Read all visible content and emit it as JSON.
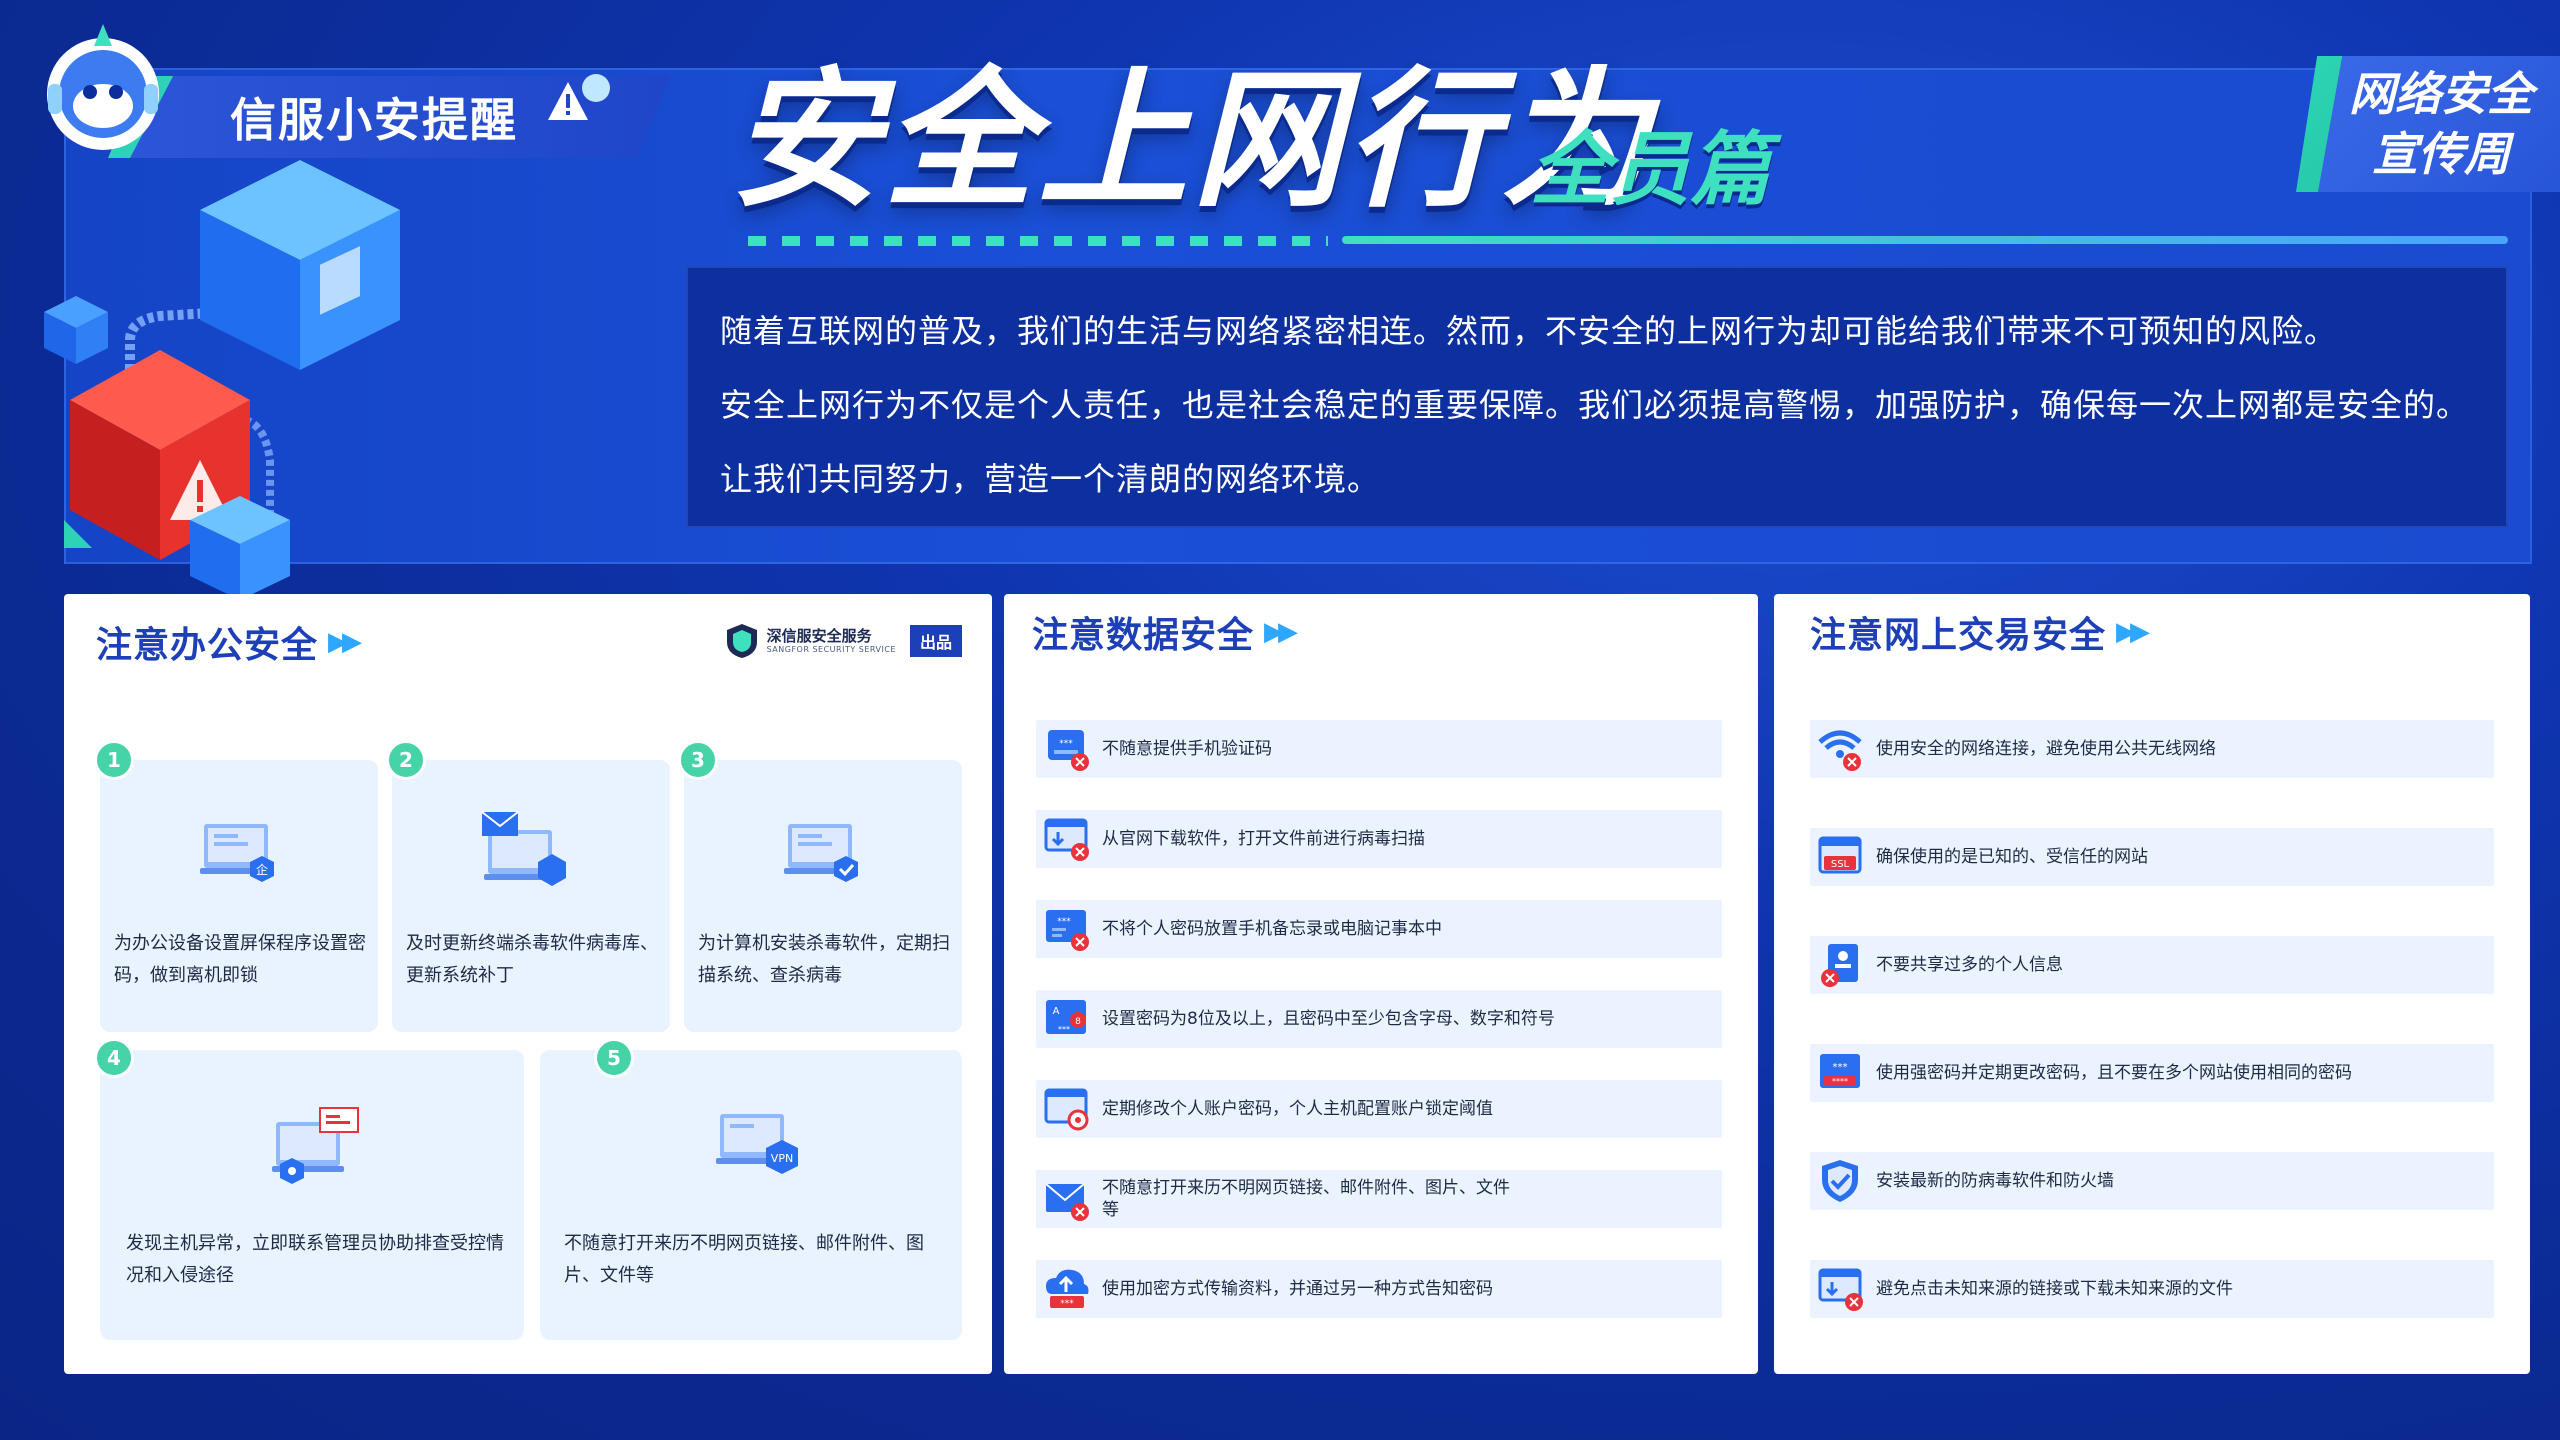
{
  "brand_tag": "信服小安提醒",
  "main_title": "安全上网行为",
  "sub_title": "全员篇",
  "corner_badge": {
    "line1": "网络安全",
    "line2": "宣传周"
  },
  "intro": {
    "paragraph1": "随着互联网的普及，我们的生活与网络紧密相连。然而，不安全的上网行为却可能给我们带来不可预知的风险。",
    "paragraph2": "安全上网行为不仅是个人责任，也是社会稳定的重要保障。我们必须提高警惕，加强防护，确保每一次上网都是安全的。让我们共同努力，营造一个清朗的网络环境。"
  },
  "vendor": {
    "name": "深信服安全服务",
    "sub": "SANGFOR SECURITY SERVICE",
    "badge": "出品"
  },
  "office": {
    "title": "注意办公安全",
    "cards": [
      {
        "num": "1",
        "text": "为办公设备设置屏保程序设置密码，做到离机即锁",
        "icon": "monitor-lock-icon"
      },
      {
        "num": "2",
        "text": "及时更新终端杀毒软件病毒库、更新系统补丁",
        "icon": "monitor-update-icon"
      },
      {
        "num": "3",
        "text": "为计算机安装杀毒软件，定期扫描系统、查杀病毒",
        "icon": "monitor-shield-icon"
      },
      {
        "num": "4",
        "text": "发现主机异常，立即联系管理员协助排查受控情况和入侵途径",
        "icon": "monitor-alert-icon"
      },
      {
        "num": "5",
        "text": "不随意打开来历不明网页链接、邮件附件、图片、文件等",
        "icon": "monitor-vpn-icon"
      }
    ],
    "vpn_label": "VPN"
  },
  "data_security": {
    "title": "注意数据安全",
    "items": [
      "不随意提供手机验证码",
      "从官网下载软件，打开文件前进行病毒扫描",
      "不将个人密码放置手机备忘录或电脑记事本中",
      "设置密码为8位及以上，且密码中至少包含字母、数字和符号",
      "定期修改个人账户密码，个人主机配置账户锁定阈值",
      "不随意打开来历不明网页链接、邮件附件、图片、文件等",
      "使用加密方式传输资料，并通过另一种方式告知密码"
    ]
  },
  "trade_security": {
    "title": "注意网上交易安全",
    "items": [
      "使用安全的网络连接，避免使用公共无线网络",
      "确保使用的是已知的、受信任的网站",
      "不要共享过多的个人信息",
      "使用强密码并定期更改密码，且不要在多个网站使用相同的密码",
      "安装最新的防病毒软件和防火墙",
      "避免点击未知来源的链接或下载未知来源的文件"
    ],
    "ssl_label": "SSL"
  },
  "colors": {
    "bg": "#0c2d9c",
    "accent_teal": "#3fe0bf",
    "title_blue": "#1d3fb8",
    "row_bg": "#eaf3ff",
    "alert_red": "#e8323c"
  }
}
